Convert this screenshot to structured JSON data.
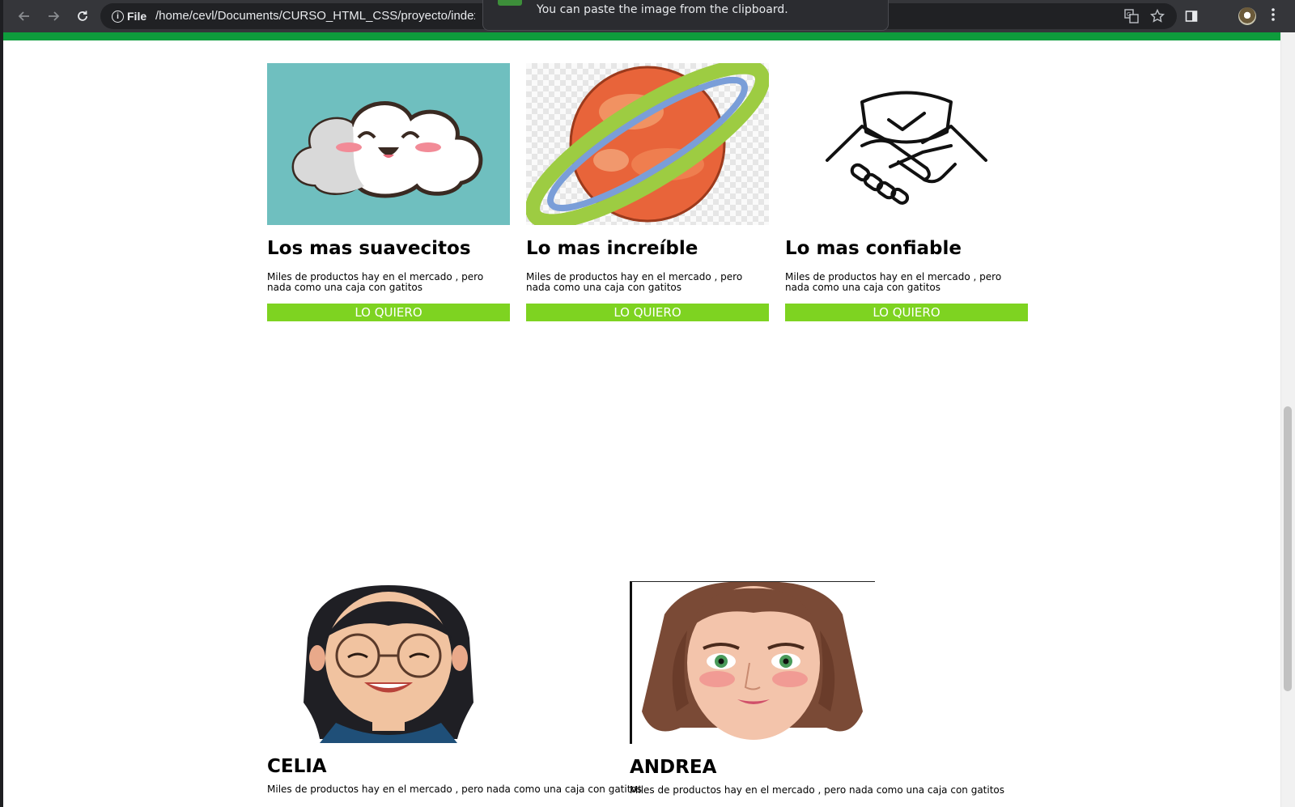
{
  "browser": {
    "site_info_label": "File",
    "url": "/home/cevl/Documents/CURSO_HTML_CSS/proyecto/index.html",
    "paste_notice": "You can paste the image from the clipboard."
  },
  "products": [
    {
      "title": "Los mas suavecitos",
      "description": "Miles de productos hay en el mercado , pero nada como una caja con gatitos",
      "button": "LO QUIERO",
      "image": "happy-cloud",
      "image_bg": "#6fbfbf"
    },
    {
      "title": "Lo mas increíble",
      "description": "Miles de productos hay en el mercado , pero nada como una caja con gatitos",
      "button": "LO QUIERO",
      "image": "ringed-planet"
    },
    {
      "title": "Lo mas confiable",
      "description": "Miles de productos hay en el mercado , pero nada como una caja con gatitos",
      "button": "LO QUIERO",
      "image": "handshake-shield"
    }
  ],
  "team": [
    {
      "name": "CELIA",
      "description": "Miles de productos hay en el mercado , pero nada como una caja con gatitos",
      "image": "woman-glasses-avatar"
    },
    {
      "name": "ANDREA",
      "description": "Miles de productos hay en el mercado , pero nada como una caja con gatitos",
      "image": "woman-brown-hair-avatar"
    }
  ],
  "colors": {
    "accent_bar": "#0e9c3c",
    "button_bg": "#7ed321",
    "toolbar": "#35363a"
  }
}
